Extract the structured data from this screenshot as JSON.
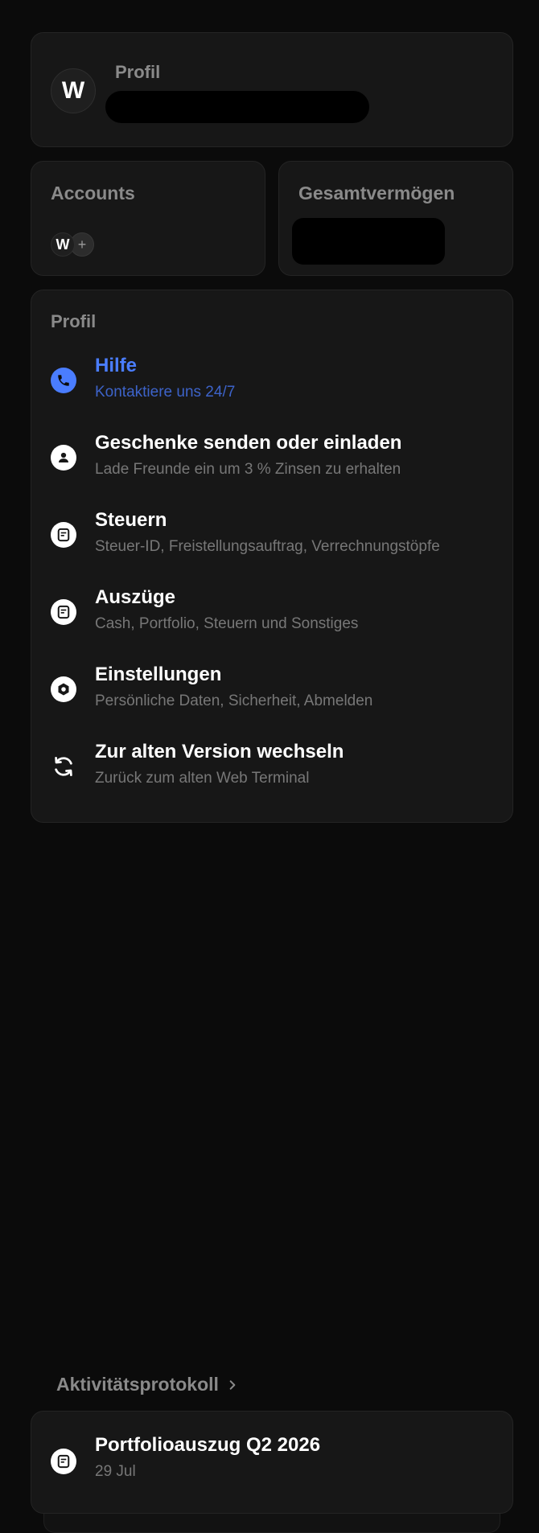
{
  "profile": {
    "avatar_initial": "W",
    "title": "Profil"
  },
  "accounts": {
    "title": "Accounts",
    "avatar_initial": "W",
    "add_symbol": "+"
  },
  "wealth": {
    "title": "Gesamtvermögen"
  },
  "menu": {
    "section_title": "Profil",
    "items": [
      {
        "label": "Hilfe",
        "sub": "Kontaktiere uns 24/7",
        "icon": "phone-icon"
      },
      {
        "label": "Geschenke senden oder einladen",
        "sub": "Lade Freunde ein um 3 % Zinsen zu erhalten",
        "icon": "user-icon"
      },
      {
        "label": "Steuern",
        "sub": "Steuer-ID, Freistellungsauftrag, Verrechnungstöpfe",
        "icon": "document-icon"
      },
      {
        "label": "Auszüge",
        "sub": "Cash, Portfolio, Steuern und Sonstiges",
        "icon": "document-icon"
      },
      {
        "label": "Einstellungen",
        "sub": "Persönliche Daten, Sicherheit, Abmelden",
        "icon": "gear-icon"
      },
      {
        "label": "Zur alten Version wechseln",
        "sub": "Zurück zum alten Web Terminal",
        "icon": "refresh-icon"
      }
    ]
  },
  "activity": {
    "header": "Aktivitätsprotokoll",
    "items": [
      {
        "title": "Portfolioauszug Q2 2026",
        "date": "29 Jul",
        "icon": "document-icon"
      }
    ]
  },
  "colors": {
    "accent": "#4a7dff",
    "background": "#0b0b0b",
    "card": "#171717"
  }
}
